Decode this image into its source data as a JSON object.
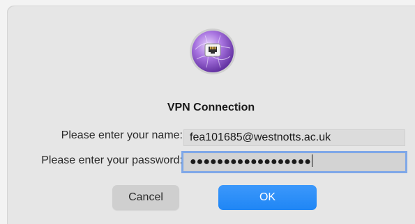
{
  "dialog": {
    "title": "VPN Connection",
    "app_icon": "network-port-icon"
  },
  "form": {
    "name_label": "Please enter your name:",
    "name_value": "fea101685@westnotts.ac.uk",
    "password_label": "Please enter your password:",
    "password_value": "●●●●●●●●●●●●●●●●●●"
  },
  "buttons": {
    "cancel_label": "Cancel",
    "ok_label": "OK"
  },
  "colors": {
    "accent": "#2a8df7",
    "focus_ring": "#7fa8e8",
    "icon_purple": "#8a4fc9"
  }
}
